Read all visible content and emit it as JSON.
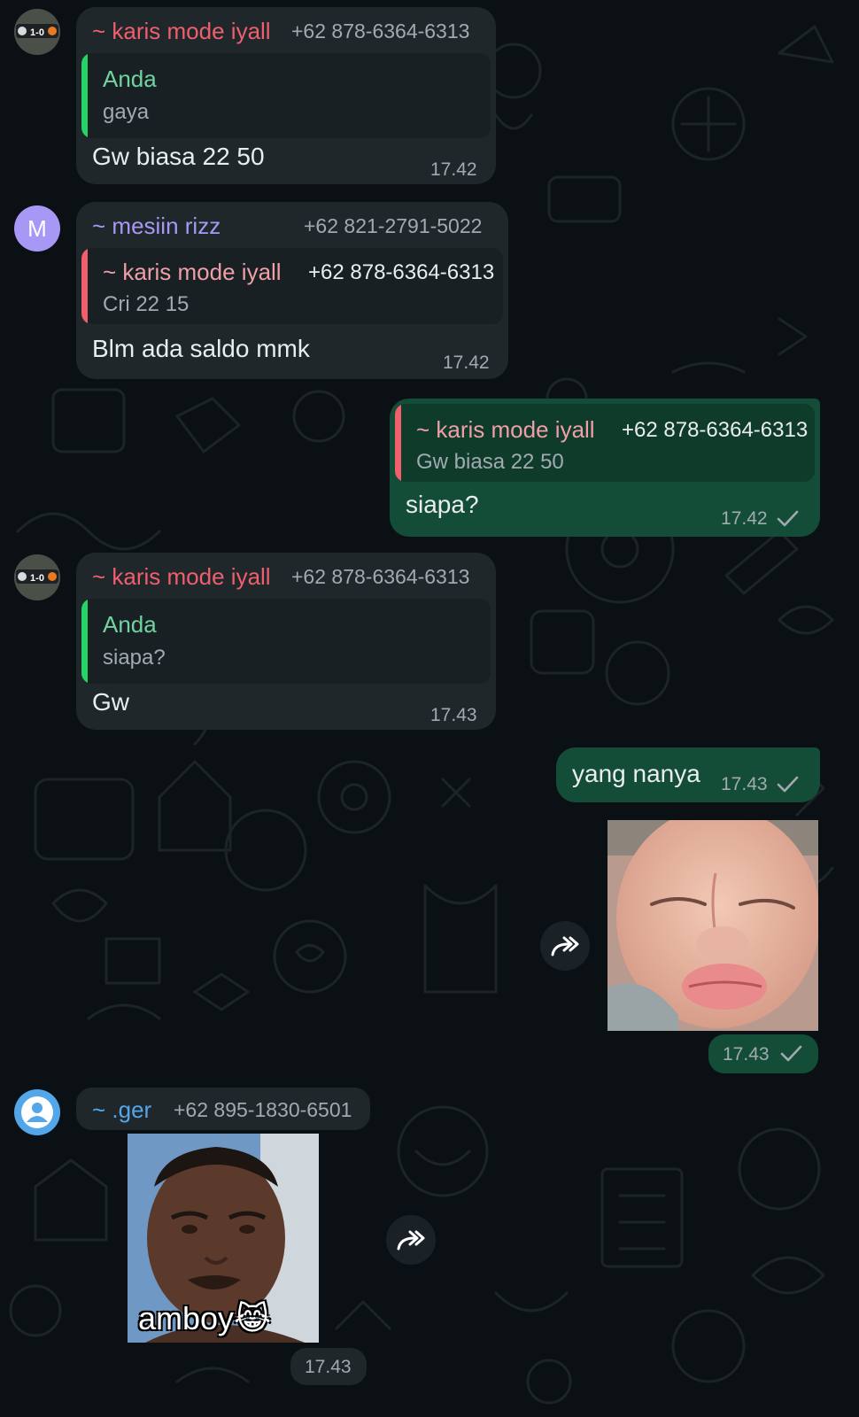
{
  "messages": {
    "m1": {
      "sender": "~ karis mode iyall",
      "phone": "+62 878-6364-6313",
      "quote_name": "Anda",
      "quote_text": "gaya",
      "text": "Gw biasa 22 50",
      "time": "17.42"
    },
    "m2": {
      "avatar_letter": "M",
      "sender": "~ mesiin rizz",
      "phone": "+62 821-2791-5022",
      "quote_name": "~ karis mode iyall",
      "quote_phone": "+62 878-6364-6313",
      "quote_text": "Cri 22 15",
      "text": "Blm ada saldo mmk",
      "time": "17.42"
    },
    "m3": {
      "quote_name": "~ karis mode iyall",
      "quote_phone": "+62 878-6364-6313",
      "quote_text": "Gw biasa 22 50",
      "text": "siapa?",
      "time": "17.42"
    },
    "m4": {
      "sender": "~ karis mode iyall",
      "phone": "+62 878-6364-6313",
      "quote_name": "Anda",
      "quote_text": "siapa?",
      "text": "Gw",
      "time": "17.43"
    },
    "m5": {
      "text": "yang nanya",
      "time": "17.43"
    },
    "m6": {
      "time": "17.43"
    },
    "m7": {
      "sender": "~ .ger",
      "phone": "+62 895-1830-6501",
      "sticker_caption": "amboy😹",
      "time": "17.43"
    }
  },
  "colors": {
    "background": "#0b1014",
    "incoming_bubble": "#1f272a",
    "outgoing_bubble": "#144d37",
    "sender_red": "#ef5f6e",
    "sender_purple": "#a898f5",
    "sender_blue": "#53a6e8",
    "quote_self": "#25d366"
  },
  "icons": [
    "single-check-icon",
    "forward-icon",
    "default-avatar-icon"
  ]
}
